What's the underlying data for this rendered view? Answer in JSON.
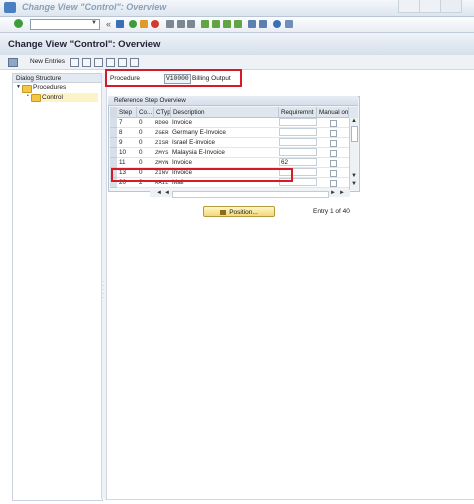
{
  "window": {
    "title": "Change View \"Control\": Overview"
  },
  "page": {
    "title": "Change View \"Control\": Overview"
  },
  "app_toolbar": {
    "new_entries": "New Entries"
  },
  "dialog_structure": {
    "header": "Dialog Structure",
    "items": [
      {
        "label": "Procedures",
        "expanded": true
      },
      {
        "label": "Control",
        "selected": true
      }
    ]
  },
  "procedure": {
    "label": "Procedure",
    "value": "V10000",
    "description": "Billing Output"
  },
  "table": {
    "title": "Reference Step Overview",
    "columns": [
      "Step",
      "Co...",
      "CTyp",
      "Description",
      "Requiremnt",
      "Manual only"
    ],
    "rows": [
      {
        "step": "7",
        "counter": "0",
        "ctyp": "RD00",
        "description": "Invoice",
        "requirement": ""
      },
      {
        "step": "8",
        "counter": "0",
        "ctyp": "ZGER",
        "description": "Germany E-Invoice",
        "requirement": ""
      },
      {
        "step": "9",
        "counter": "0",
        "ctyp": "ZISR",
        "description": "Israel E-invoice",
        "requirement": ""
      },
      {
        "step": "10",
        "counter": "0",
        "ctyp": "ZMYS",
        "description": "Malaysia E-Invoice",
        "requirement": ""
      },
      {
        "step": "11",
        "counter": "0",
        "ctyp": "ZMYN",
        "description": "Invoice",
        "requirement": "62"
      },
      {
        "step": "13",
        "counter": "0",
        "ctyp": "ZINV",
        "description": "Invoice",
        "requirement": ""
      },
      {
        "step": "20",
        "counter": "2",
        "ctyp": "MAIL",
        "description": "Mail",
        "requirement": ""
      }
    ]
  },
  "position_button": "Position...",
  "entry_info": "Entry 1 of 40",
  "colors": {
    "highlight": "#d71a27",
    "folder": "#f3c744",
    "button": "#f3d87a"
  }
}
